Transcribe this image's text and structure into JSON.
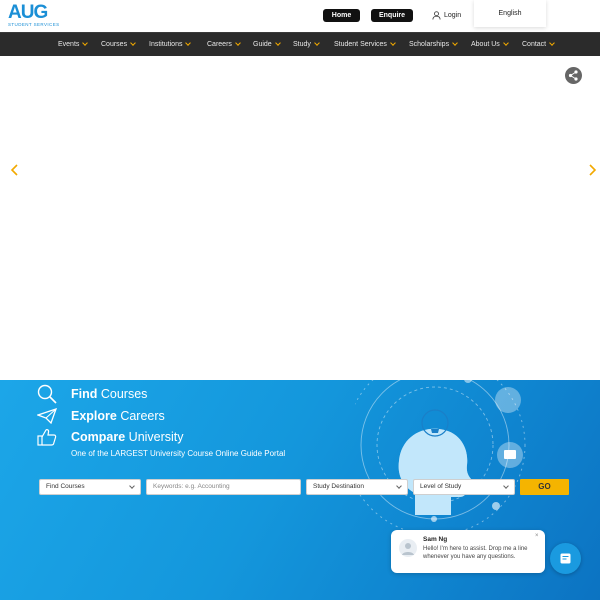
{
  "header": {
    "logo_text": "AUG",
    "logo_sub": "STUDENT SERVICES",
    "home": "Home",
    "enquire": "Enquire",
    "login": "Login",
    "language": "English"
  },
  "nav": {
    "items": [
      {
        "label": "Events"
      },
      {
        "label": "Courses"
      },
      {
        "label": "Institutions"
      },
      {
        "label": "Careers"
      },
      {
        "label": "Guide"
      },
      {
        "label": "Study"
      },
      {
        "label": "Student Services"
      },
      {
        "label": "Scholarships"
      },
      {
        "label": "About Us"
      },
      {
        "label": "Contact"
      }
    ]
  },
  "search": {
    "rows": [
      {
        "bold": "Find",
        "rest": " Courses",
        "icon": "magnifier-icon"
      },
      {
        "bold": "Explore",
        "rest": " Careers",
        "icon": "paper-plane-icon"
      },
      {
        "bold": "Compare",
        "rest": " University",
        "icon": "thumbs-up-icon"
      }
    ],
    "tagline": "One of the LARGEST University Course Online Guide Portal",
    "find_courses": "Find Courses",
    "keywords_placeholder": "Keywords: e.g. Accounting",
    "study_destination": "Study Destination",
    "level_of_study": "Level of Study",
    "go": "GO"
  },
  "chat": {
    "name": "Sam Ng",
    "message": "Hello! I'm here to assist. Drop me a line whenever you have any questions.",
    "close": "×"
  },
  "colors": {
    "brand_blue": "#1b8fd6",
    "nav_bg": "#2b2b2b",
    "accent_yellow": "#f5b400"
  }
}
